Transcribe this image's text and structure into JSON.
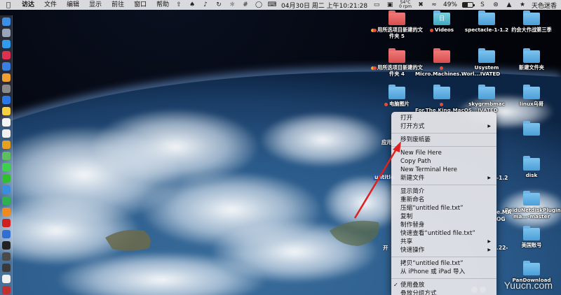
{
  "menubar": {
    "app_name": "访达",
    "menus": [
      "文件",
      "编辑",
      "显示",
      "前往",
      "窗口",
      "帮助"
    ],
    "temperature": [
      "54°C",
      "0 rpm"
    ],
    "battery_percent": "49%",
    "battery_level": 0.49,
    "datetime": "04月30日 周二 上午10:21:28",
    "user_name": "天色迷香"
  },
  "desktop_items": [
    {
      "label": "用所选项目新建的文件夹 5",
      "color": "red",
      "tags": "orange-red"
    },
    {
      "label": "Videos",
      "color": "teal",
      "tags": "red",
      "glyph": "日"
    },
    {
      "label": "spectacle-1-1.2",
      "color": "blue"
    },
    {
      "label": "约会大作战第三季",
      "color": "blue"
    },
    {
      "label": "用所选项目新建的文件夹 4",
      "color": "red",
      "tags": "orange-red"
    },
    {
      "label": "Micro.Machines.Worl...IVATED",
      "color": "red",
      "tags": "red"
    },
    {
      "label": "Usystem",
      "color": "blue"
    },
    {
      "label": "新建文件夹",
      "color": "blue"
    },
    {
      "label": "电脑图片",
      "color": "blue",
      "tags": "red"
    },
    {
      "label": "For.The.King.MacOS...IVATED",
      "color": "blue",
      "tags": "red"
    },
    {
      "label": "skygrmbmac",
      "color": "blue"
    },
    {
      "label": "linux乌哥",
      "color": "blue"
    },
    {
      "label": "",
      "color": "blue"
    },
    {
      "label": "disk",
      "color": "blue"
    },
    {
      "label": "BaiduNetdiskPlugin-ma...-master",
      "color": "blue"
    },
    {
      "label": "美国账号",
      "color": "blue"
    },
    {
      "label": "PanDownload",
      "color": "blue"
    }
  ],
  "partial_labels": {
    "app": "应用",
    "selected_file": "untitle",
    "open": "开",
    "ma": "e.MA",
    "og": "OG",
    "v12": "-1.2",
    "v22": ".22-"
  },
  "context_menu": {
    "groups": [
      [
        {
          "label": "打开"
        },
        {
          "label": "打开方式",
          "submenu": true
        }
      ],
      [
        {
          "label": "移到废纸篓"
        }
      ],
      [
        {
          "label": "New File Here"
        },
        {
          "label": "Copy Path"
        },
        {
          "label": "New Terminal Here"
        },
        {
          "label": "新建文件",
          "submenu": true
        }
      ],
      [
        {
          "label": "显示简介"
        },
        {
          "label": "重新命名"
        },
        {
          "label": "压缩“untitled file.txt”"
        },
        {
          "label": "复制"
        },
        {
          "label": "制作替身"
        },
        {
          "label": "快速查看“untitled file.txt”"
        },
        {
          "label": "共享",
          "submenu": true
        },
        {
          "label": "快速操作",
          "submenu": true
        }
      ],
      [
        {
          "label": "拷贝“untitled file.txt”"
        },
        {
          "label": "从 iPhone 或 iPad 导入"
        }
      ],
      [
        {
          "label": "使用叠放",
          "checked": true
        },
        {
          "label": "叠放分组方式"
        }
      ]
    ]
  },
  "watermark": "Yuucn.com",
  "colors": {
    "menu_highlight": "#3a7ee8",
    "annotation_arrow": "#e02020"
  }
}
